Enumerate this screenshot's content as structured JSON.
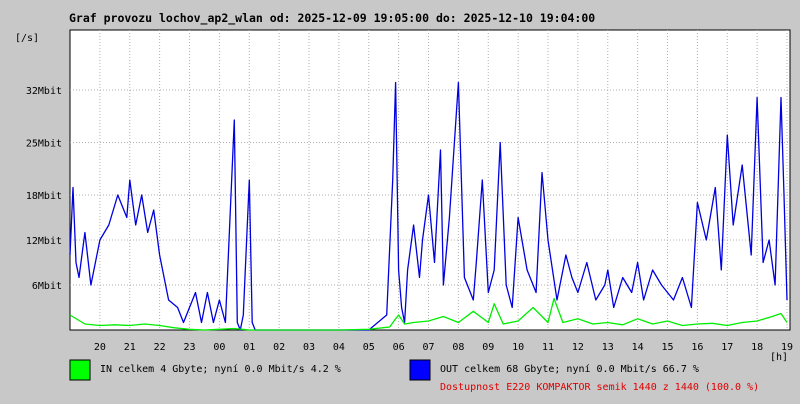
{
  "chart_data": {
    "type": "line",
    "title": "Graf provozu lochov_ap2_wlan od: 2025-12-09 19:05:00 do: 2025-12-10 19:04:00",
    "ylabel": "[/s]",
    "xlabel": "[h]",
    "ylim_mbit": [
      0,
      40
    ],
    "xlim_hours": [
      19.0,
      43.1
    ],
    "grid": true,
    "x_ticks": [
      "20",
      "21",
      "22",
      "23",
      "00",
      "01",
      "02",
      "03",
      "04",
      "05",
      "06",
      "07",
      "08",
      "09",
      "10",
      "11",
      "12",
      "13",
      "14",
      "15",
      "16",
      "17",
      "18",
      "19"
    ],
    "y_ticks": [
      {
        "label": "6Mbit",
        "value": 6
      },
      {
        "label": "12Mbit",
        "value": 12
      },
      {
        "label": "18Mbit",
        "value": 18
      },
      {
        "label": "25Mbit",
        "value": 25
      },
      {
        "label": "32Mbit",
        "value": 32
      }
    ],
    "series": [
      {
        "name": "IN",
        "color": "#00ee00",
        "x": [
          19.0,
          19.5,
          20.0,
          20.5,
          21.0,
          21.5,
          22.0,
          22.5,
          23.0,
          23.5,
          24.0,
          24.5,
          25.0,
          25.5,
          26.0,
          27.0,
          28.0,
          29.0,
          29.7,
          29.9,
          30.0,
          30.2,
          30.5,
          31.0,
          31.5,
          32.0,
          32.5,
          33.0,
          33.2,
          33.5,
          34.0,
          34.5,
          35.0,
          35.2,
          35.5,
          36.0,
          36.5,
          37.0,
          37.5,
          38.0,
          38.5,
          39.0,
          39.5,
          40.0,
          40.5,
          41.0,
          41.5,
          42.0,
          42.5,
          42.8,
          43.0
        ],
        "values": [
          2.0,
          0.8,
          0.6,
          0.7,
          0.6,
          0.8,
          0.6,
          0.3,
          0.1,
          0.0,
          0.1,
          0.2,
          0.0,
          0.0,
          0.0,
          0.0,
          0.0,
          0.1,
          0.4,
          1.5,
          2.0,
          0.8,
          1.0,
          1.2,
          1.8,
          1.0,
          2.5,
          1.0,
          3.5,
          0.8,
          1.2,
          3.0,
          1.0,
          4.2,
          1.0,
          1.5,
          0.8,
          1.0,
          0.7,
          1.5,
          0.8,
          1.2,
          0.6,
          0.8,
          0.9,
          0.6,
          1.0,
          1.2,
          1.8,
          2.2,
          1.0
        ]
      },
      {
        "name": "OUT",
        "color": "#0000e0",
        "x": [
          19.0,
          19.1,
          19.2,
          19.3,
          19.5,
          19.7,
          20.0,
          20.3,
          20.6,
          20.9,
          21.0,
          21.2,
          21.4,
          21.6,
          21.8,
          22.0,
          22.3,
          22.6,
          22.8,
          23.0,
          23.2,
          23.4,
          23.6,
          23.8,
          24.0,
          24.2,
          24.5,
          24.6,
          24.7,
          24.8,
          25.0,
          25.1,
          25.2,
          25.3,
          25.5,
          26.0,
          27.0,
          28.0,
          29.0,
          29.6,
          29.8,
          29.9,
          30.0,
          30.1,
          30.2,
          30.3,
          30.5,
          30.7,
          30.8,
          31.0,
          31.2,
          31.4,
          31.5,
          31.7,
          32.0,
          32.2,
          32.5,
          32.6,
          32.8,
          33.0,
          33.2,
          33.4,
          33.6,
          33.8,
          34.0,
          34.3,
          34.6,
          34.8,
          35.0,
          35.3,
          35.6,
          35.8,
          36.0,
          36.3,
          36.6,
          36.9,
          37.0,
          37.2,
          37.5,
          37.8,
          38.0,
          38.2,
          38.5,
          38.8,
          39.0,
          39.2,
          39.5,
          39.8,
          40.0,
          40.3,
          40.6,
          40.8,
          41.0,
          41.2,
          41.5,
          41.8,
          42.0,
          42.2,
          42.4,
          42.6,
          42.8,
          42.9,
          43.0
        ],
        "values": [
          10,
          19,
          9,
          7,
          13,
          6,
          12,
          14,
          18,
          15,
          20,
          14,
          18,
          13,
          16,
          10,
          4,
          3,
          1,
          3,
          5,
          1,
          5,
          1,
          4,
          1,
          28,
          1,
          0,
          2,
          20,
          1,
          0,
          0,
          0,
          0,
          0,
          0,
          0,
          2,
          20,
          33,
          8,
          3,
          1,
          8,
          14,
          7,
          12,
          18,
          9,
          24,
          6,
          15,
          33,
          7,
          4,
          9,
          20,
          5,
          8,
          25,
          6,
          3,
          15,
          8,
          5,
          21,
          12,
          4,
          10,
          7,
          5,
          9,
          4,
          6,
          8,
          3,
          7,
          5,
          9,
          4,
          8,
          6,
          5,
          4,
          7,
          3,
          17,
          12,
          19,
          8,
          26,
          14,
          22,
          10,
          31,
          9,
          12,
          6,
          31,
          18,
          4
        ]
      }
    ]
  },
  "legend": {
    "in": {
      "text": "IN celkem 4 Gbyte; nyní   0.0 Mbit/s 4.2 %",
      "color": "#00ff00"
    },
    "out": {
      "text": "OUT celkem 68 Gbyte; nyní   0.0 Mbit/s 66.7 %",
      "color": "#0000ff"
    }
  },
  "availability": "Dostupnost E220 KOMPAKTOR semik 1440 z 1440 (100.0 %)"
}
